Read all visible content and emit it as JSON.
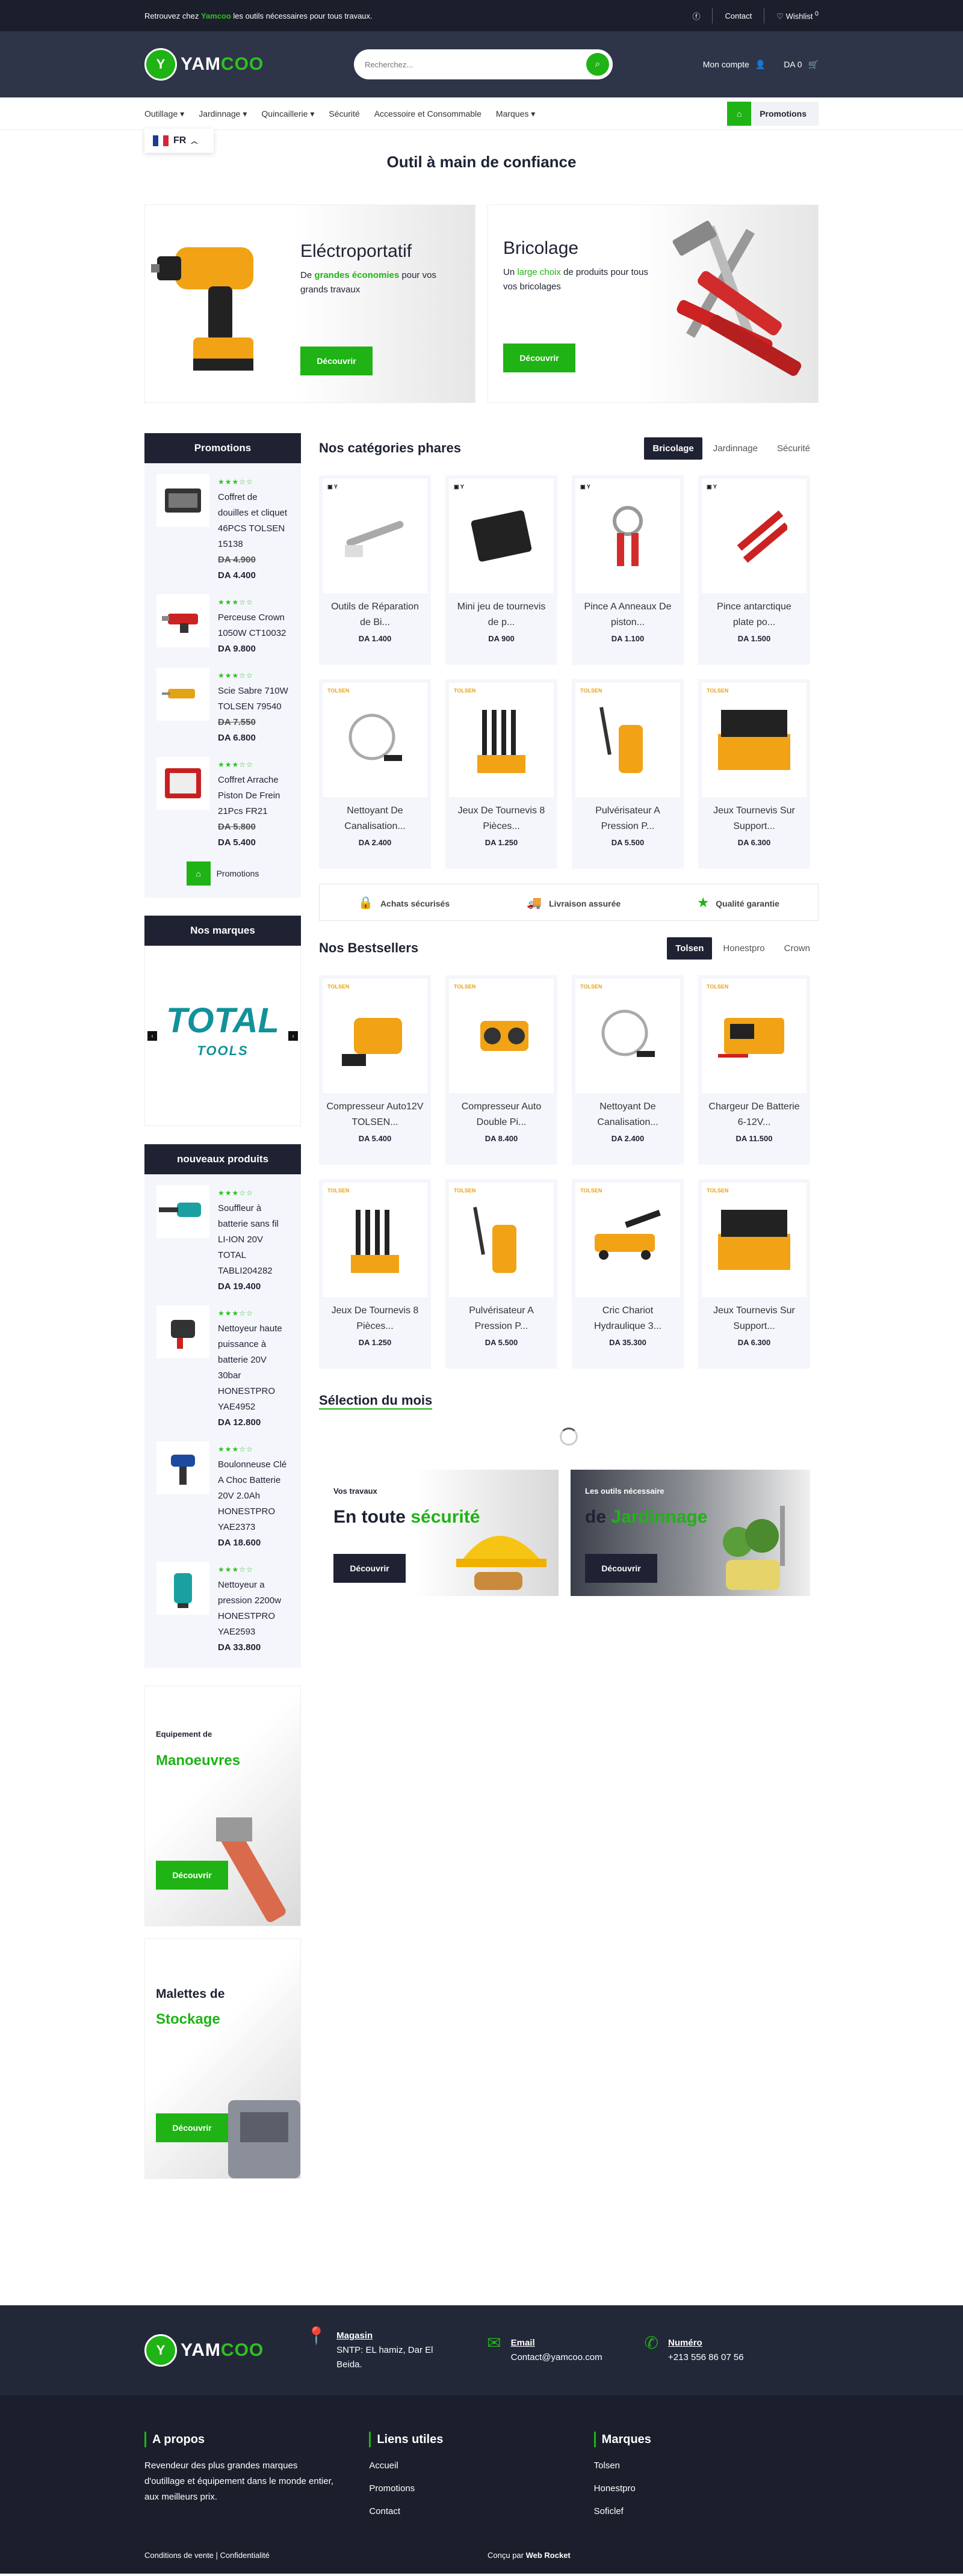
{
  "topbar": {
    "text_before": "Retrouvez chez ",
    "brand": "Yamcoo",
    "text_after": " les outils nécessaires pour tous travaux.",
    "contact": "Contact",
    "wishlist": "Wishlist",
    "wishlist_count": "0"
  },
  "header": {
    "logo_prefix": "YAM",
    "logo_suffix": "COO",
    "search_placeholder": "Recherchez...",
    "account": "Mon compte",
    "cart": "DA 0"
  },
  "nav": {
    "items": [
      "Outillage",
      "Jardinnage",
      "Quincaillerie",
      "Sécurité",
      "Accessoire et Consommable",
      "Marques"
    ],
    "promo": "Promotions"
  },
  "lang": {
    "code": "FR"
  },
  "page": {
    "title": "Outil à main de confiance"
  },
  "banners": [
    {
      "title": "Eléctroportatif",
      "text_a": "De ",
      "highlight": "grandes économies",
      "text_b": " pour vos grands travaux",
      "button": "Découvrir"
    },
    {
      "title": "Bricolage",
      "text_a": "Un ",
      "highlight": "large choix",
      "text_b": " de produits pour tous vos bricolages",
      "button": "Découvrir"
    }
  ],
  "promotions": {
    "title": "Promotions",
    "link": "Promotions",
    "items": [
      {
        "name": "Coffret de douilles et cliquet 46PCS TOLSEN 15138",
        "old": "DA 4.900",
        "price": "DA 4.400"
      },
      {
        "name": "Perceuse Crown 1050W CT10032",
        "old": "",
        "price": "DA 9.800"
      },
      {
        "name": "Scie Sabre 710W TOLSEN 79540",
        "old": "DA 7.550",
        "price": "DA 6.800"
      },
      {
        "name": "Coffret Arrache Piston De Frein 21Pcs FR21",
        "old": "DA 5.800",
        "price": "DA 5.400"
      }
    ]
  },
  "brands": {
    "title": "Nos marques",
    "logo": "TOTAL",
    "logo_sub": "TOOLS"
  },
  "new_products": {
    "title": "nouveaux produits",
    "items": [
      {
        "name": "Souffleur à batterie sans fil LI-ION 20V TOTAL TABLI204282",
        "price": "DA 19.400"
      },
      {
        "name": "Nettoyeur haute puissance à batterie 20V 30bar HONESTPRO YAE4952",
        "price": "DA 12.800"
      },
      {
        "name": "Boulonneuse Clé A Choc Batterie 20V 2.0Ah HONESTPRO YAE2373",
        "price": "DA 18.600"
      },
      {
        "name": "Nettoyeur a pression 2200w HONESTPRO YAE2593",
        "price": "DA 33.800"
      }
    ]
  },
  "side_promos": [
    {
      "small": "Equipement de",
      "title": "Manoeuvres",
      "button": "Découvrir"
    },
    {
      "small": "Malettes de",
      "title": "Stockage",
      "button": "Découvrir"
    }
  ],
  "categories": {
    "title": "Nos catégories phares",
    "tabs": [
      "Bricolage",
      "Jardinnage",
      "Sécurité"
    ],
    "products": [
      {
        "name": "Outils de Réparation de Bi...",
        "price": "DA 1.400"
      },
      {
        "name": "Mini jeu de tournevis de p...",
        "price": "DA 900"
      },
      {
        "name": "Pince A Anneaux De piston...",
        "price": "DA 1.100"
      },
      {
        "name": "Pince antarctique plate po...",
        "price": "DA 1.500"
      },
      {
        "name": "Nettoyant De Canalisation...",
        "price": "DA 2.400"
      },
      {
        "name": "Jeux De Tournevis 8 Pièces...",
        "price": "DA 1.250"
      },
      {
        "name": "Pulvérisateur A Pression P...",
        "price": "DA 5.500"
      },
      {
        "name": "Jeux Tournevis Sur Support...",
        "price": "DA 6.300"
      }
    ]
  },
  "features": [
    "Achats sécurisés",
    "Livraison assurée",
    "Qualité garantie"
  ],
  "bestsellers": {
    "title": "Nos Bestsellers",
    "tabs": [
      "Tolsen",
      "Honestpro",
      "Crown"
    ],
    "products": [
      {
        "name": "Compresseur Auto12V TOLSEN...",
        "price": "DA 5.400"
      },
      {
        "name": "Compresseur Auto Double Pi...",
        "price": "DA 8.400"
      },
      {
        "name": "Nettoyant De Canalisation...",
        "price": "DA 2.400"
      },
      {
        "name": "Chargeur De Batterie 6-12V...",
        "price": "DA 11.500"
      },
      {
        "name": "Jeux De Tournevis 8 Pièces...",
        "price": "DA 1.250"
      },
      {
        "name": "Pulvérisateur A Pression P...",
        "price": "DA 5.500"
      },
      {
        "name": "Cric Chariot Hydraulique 3...",
        "price": "DA 35.300"
      },
      {
        "name": "Jeux Tournevis Sur Support...",
        "price": "DA 6.300"
      }
    ]
  },
  "month": {
    "title": "Sélection du mois",
    "banners": [
      {
        "small": "Vos travaux",
        "title_a": "En toute ",
        "title_b": "sécurité",
        "button": "Découvrir"
      },
      {
        "small": "Les outils nécessaire",
        "title_a": "de ",
        "title_b": "Jardinnage",
        "button": "Découvrir"
      }
    ]
  },
  "footer": {
    "contacts": [
      {
        "label": "Magasin",
        "value": "SNTP: EL hamiz, Dar El Beida."
      },
      {
        "label": "Email",
        "value": "Contact@yamcoo.com"
      },
      {
        "label": "Numéro",
        "value": "+213 556 86 07 56"
      }
    ],
    "about_title": "A propos",
    "about_text": "Revendeur des plus grandes marques d'outillage et équipement dans le monde entier, aux meilleurs prix.",
    "links_title": "Liens utiles",
    "links": [
      "Accueil",
      "Promotions",
      "Contact"
    ],
    "brands_title": "Marques",
    "brands": [
      "Tolsen",
      "Honestpro",
      "Soficlef"
    ],
    "legal": "Conditions de vente | Confidentialité",
    "credit_a": "Conçu par ",
    "credit_b": "Web Rocket"
  },
  "colors": {
    "accent": "#1fb315",
    "dark": "#1e2233",
    "header": "#2e3548",
    "topbar": "#1b1f2c"
  }
}
